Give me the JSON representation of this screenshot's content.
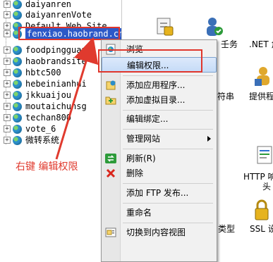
{
  "tree": {
    "sites": [
      {
        "label": "daiyanren",
        "expanded": false
      },
      {
        "label": "daiyanrenVote",
        "expanded": false
      },
      {
        "label": "Default Web Site",
        "expanded": false
      },
      {
        "label": "fenxiao.haobrand.cn",
        "expanded": false,
        "selected": true
      },
      {
        "label": "foodpingguan",
        "expanded": false
      },
      {
        "label": "haobrandsite",
        "expanded": false
      },
      {
        "label": "hbtc500",
        "expanded": false
      },
      {
        "label": "hebeinianhui",
        "expanded": false
      },
      {
        "label": "jkkuaijou",
        "expanded": false
      },
      {
        "label": "moutaichunsg",
        "expanded": false
      },
      {
        "label": "techan800",
        "expanded": false
      },
      {
        "label": "vote_6",
        "expanded": false
      },
      {
        "label": "微转系统",
        "expanded": false
      }
    ]
  },
  "annotation": {
    "text": "右键 编辑权限"
  },
  "context_menu": {
    "items": [
      {
        "label": "浏览",
        "icon": "browse-icon"
      },
      {
        "label": "编辑权限...",
        "highlighted": true
      },
      {
        "label": "添加应用程序...",
        "icon": "add-application-icon"
      },
      {
        "label": "添加虚拟目录...",
        "icon": "add-virtual-directory-icon"
      },
      {
        "label": "编辑绑定..."
      },
      {
        "label": "管理网站",
        "has_submenu": true
      },
      {
        "label": "刷新(R)",
        "icon": "refresh-icon"
      },
      {
        "label": "删除",
        "icon": "delete-icon"
      },
      {
        "label": "添加 FTP 发布..."
      },
      {
        "label": "重命名"
      },
      {
        "label": "切换到内容视图",
        "icon": "content-view-icon"
      }
    ]
  },
  "features": {
    "items": [
      {
        "label": "壬务",
        "icon": "task-icon"
      },
      {
        "label": ".NET 角",
        "icon": "net-roles-icon"
      },
      {
        "label": "符串",
        "icon": "strings-icon"
      },
      {
        "label": "提供程",
        "icon": "providers-icon"
      },
      {
        "label": "HTTP 响",
        "icon": "http-response-icon"
      },
      {
        "label": "头",
        "icon": ""
      },
      {
        "label": "类型",
        "icon": ""
      },
      {
        "label": "SSL 设",
        "icon": "ssl-lock-icon"
      }
    ]
  }
}
